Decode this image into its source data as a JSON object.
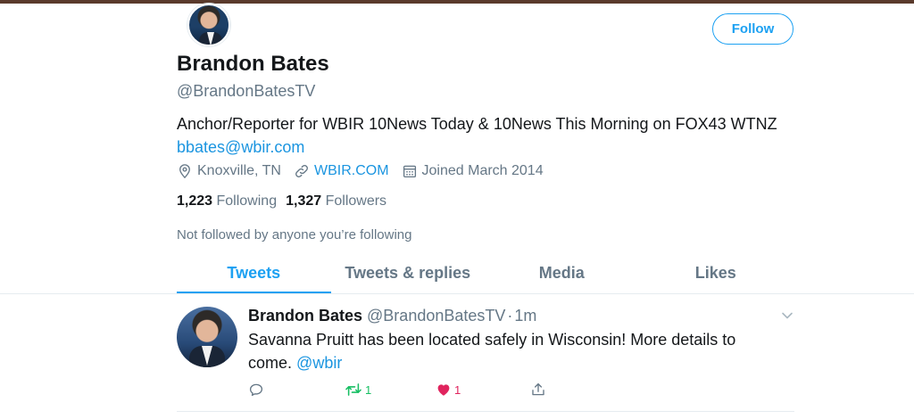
{
  "profile": {
    "name": "Brandon Bates",
    "handle": "@BrandonBatesTV",
    "bio_text": "Anchor/Reporter for WBIR 10News Today & 10News This Morning on FOX43 WTNZ",
    "bio_email": "bbates@wbir.com",
    "location": "Knoxville, TN",
    "website": "WBIR.COM",
    "joined": "Joined March 2014",
    "following_count": "1,223",
    "following_label": "Following",
    "followers_count": "1,327",
    "followers_label": "Followers",
    "followed_by_text": "Not followed by anyone you’re following",
    "follow_button_label": "Follow"
  },
  "tabs": [
    {
      "label": "Tweets",
      "active": true
    },
    {
      "label": "Tweets & replies",
      "active": false
    },
    {
      "label": "Media",
      "active": false
    },
    {
      "label": "Likes",
      "active": false
    }
  ],
  "tweet": {
    "author_name": "Brandon Bates",
    "author_handle": "@BrandonBatesTV",
    "separator": "·",
    "time": "1m",
    "text": "Savanna Pruitt has been located safely in Wisconsin! More details to come.",
    "mention": "@wbir",
    "retweet_count": "1",
    "like_count": "1"
  },
  "icons": {
    "location": "map-pin-icon",
    "website": "link-icon",
    "joined": "calendar-icon",
    "reply": "reply-icon",
    "retweet": "retweet-icon",
    "like": "heart-icon",
    "share": "share-icon",
    "menu": "chevron-down-icon"
  },
  "colors": {
    "accent": "#1da1f2",
    "link": "#1b95e0",
    "retweet": "#17bf63",
    "like": "#e0245e",
    "secondary_text": "#657786"
  }
}
